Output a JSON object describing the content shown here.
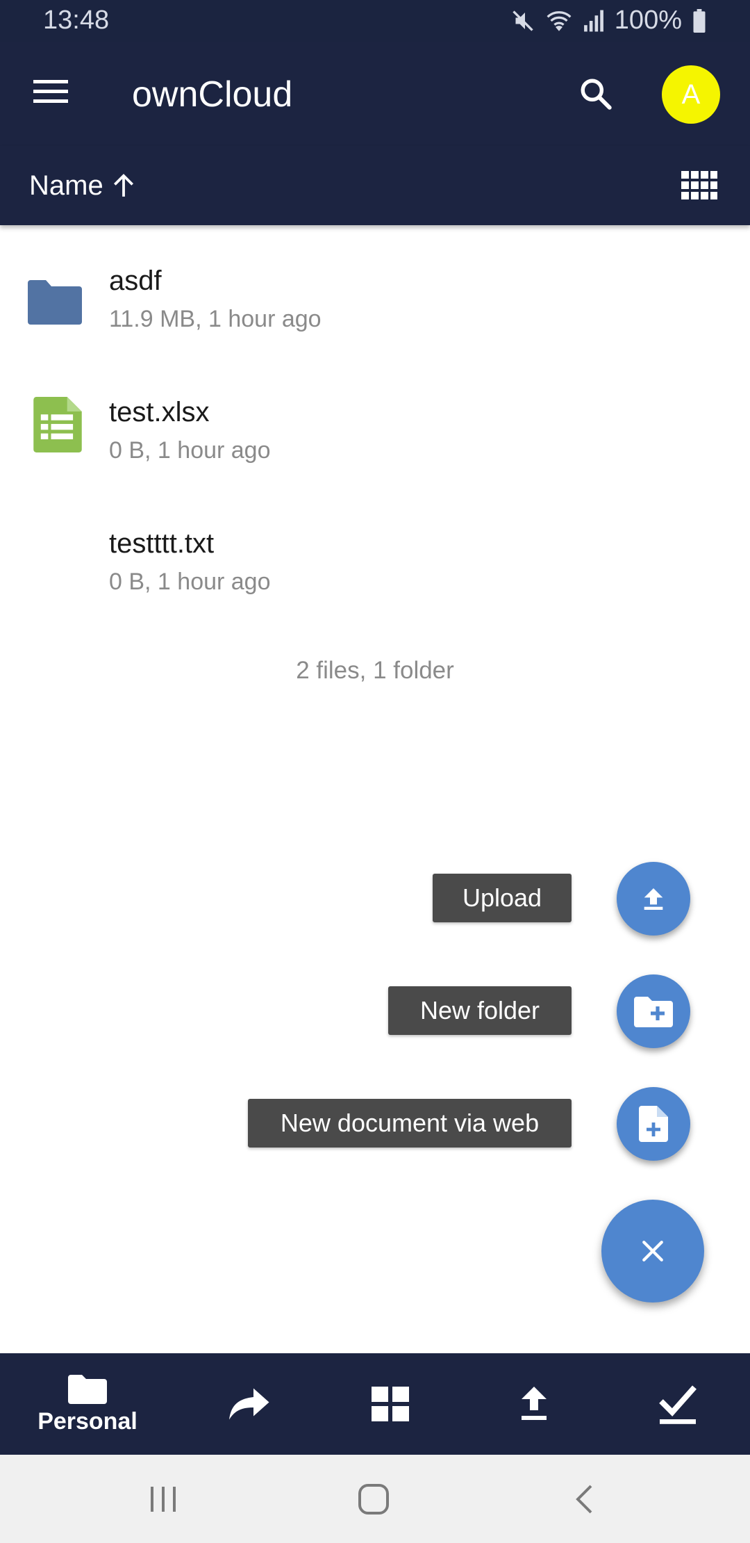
{
  "status_bar": {
    "time": "13:48",
    "battery": "100%",
    "icons": [
      "mute-icon",
      "wifi-icon",
      "signal-icon",
      "battery-icon"
    ]
  },
  "app_bar": {
    "title": "ownCloud",
    "avatar_letter": "A",
    "avatar_color": "#f5f500",
    "background": "#1c2441"
  },
  "sort_bar": {
    "label": "Name",
    "direction_icon": "arrow-up-icon",
    "view_toggle_icon": "grid-view-icon"
  },
  "files": [
    {
      "name": "asdf",
      "meta": "11.9 MB, 1 hour ago",
      "icon": "folder-icon"
    },
    {
      "name": "test.xlsx",
      "meta": "0 B, 1 hour ago",
      "icon": "spreadsheet-icon"
    },
    {
      "name": "testttt.txt",
      "meta": "0 B, 1 hour ago",
      "icon": ""
    }
  ],
  "summary": "2 files, 1 folder",
  "fab_menu": {
    "items": [
      {
        "label": "Upload",
        "icon": "upload-icon"
      },
      {
        "label": "New folder",
        "icon": "new-folder-icon"
      },
      {
        "label": "New document via web",
        "icon": "new-document-icon"
      }
    ],
    "main_icon": "close-icon",
    "accent": "#4f86cf"
  },
  "bottom_nav": {
    "items": [
      {
        "label": "Personal",
        "icon": "folder-icon"
      },
      {
        "label": "",
        "icon": "share-icon"
      },
      {
        "label": "",
        "icon": "dashboard-icon"
      },
      {
        "label": "",
        "icon": "upload-icon"
      },
      {
        "label": "",
        "icon": "check-icon"
      }
    ]
  },
  "system_nav": [
    "recent-apps-icon",
    "home-icon",
    "back-icon"
  ]
}
